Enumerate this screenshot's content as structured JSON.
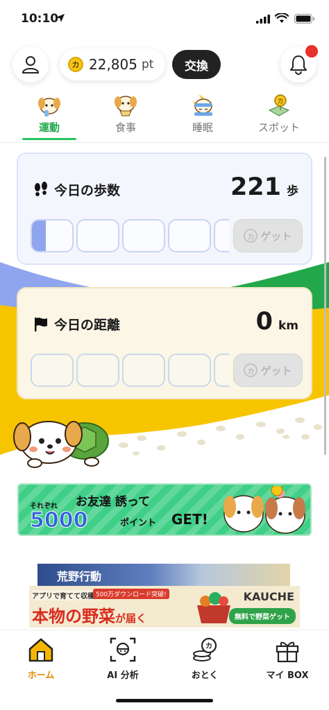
{
  "status_bar": {
    "time": "10:10"
  },
  "header": {
    "points_value": "22,805",
    "points_unit": "pt",
    "coin_mark": "カ",
    "exchange_label": "交換"
  },
  "tabs": [
    {
      "label": "運動",
      "active": true,
      "icon": "exercise-icon"
    },
    {
      "label": "食事",
      "active": false,
      "icon": "meal-icon"
    },
    {
      "label": "睡眠",
      "active": false,
      "icon": "sleep-icon"
    },
    {
      "label": "スポット",
      "active": false,
      "icon": "spot-icon"
    }
  ],
  "cards": {
    "steps": {
      "title": "今日の歩数",
      "value": "221",
      "unit": "歩",
      "get_label": "ゲット",
      "get_coin": "カ",
      "progress_first_slot": 0.35
    },
    "distance": {
      "title": "今日の距離",
      "value": "0",
      "unit": "km",
      "get_label": "ゲット",
      "get_coin": "カ"
    }
  },
  "banner_friend": {
    "line1": "お友達 誘って",
    "small": "それぞれ",
    "big": "5000",
    "mid": "ポイント",
    "get": "GET!"
  },
  "ad": {
    "top_label": "荒野行動",
    "line1": "アプリで育てて収穫！",
    "badge": "500万ダウンロード突破!",
    "line2_main": "本物の野菜",
    "line2_suffix": "が届く",
    "brand": "KAUCHE",
    "cta": "無料で野菜ゲット"
  },
  "bottom_nav": [
    {
      "label": "ホーム",
      "active": true,
      "icon": "home-icon"
    },
    {
      "label": "AI 分析",
      "active": false,
      "icon": "ai-scan-icon"
    },
    {
      "label": "おとく",
      "active": false,
      "icon": "coins-icon"
    },
    {
      "label": "マイ BOX",
      "active": false,
      "icon": "gift-box-icon"
    }
  ],
  "colors": {
    "accent_green": "#22a84a",
    "home_active": "#e08a00",
    "progress_fill": "#8fa5ee",
    "notification_dot": "#e8322b"
  }
}
